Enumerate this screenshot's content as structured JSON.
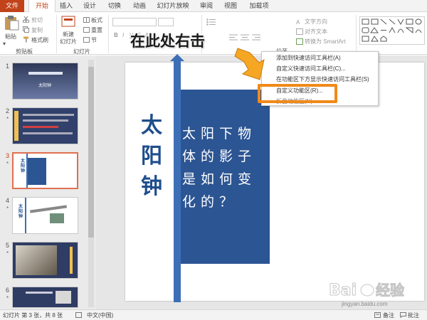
{
  "tabs": [
    "文件",
    "开始",
    "插入",
    "设计",
    "切换",
    "动画",
    "幻灯片放映",
    "审阅",
    "视图",
    "加载项"
  ],
  "ribbon": {
    "paste": "粘贴",
    "cut": "剪切",
    "copy": "复制",
    "format_painter": "格式刷",
    "clipboard_group": "剪贴板",
    "new_slide_line1": "新建",
    "new_slide_line2": "幻灯片",
    "layout": "板式",
    "reset": "重置",
    "section": "节",
    "slides_group": "幻灯片",
    "paragraph_group": "段落",
    "text_direction": "文字方向",
    "align_text": "对齐文本",
    "convert_smartart": "转换为 SmartArt"
  },
  "annotation": {
    "text": "在此处右击"
  },
  "context_menu": {
    "items": [
      "添加到快速访问工具栏(A)",
      "自定义快速访问工具栏(C)...",
      "在功能区下方显示快速访问工具栏(S)",
      "自定义功能区(R)...",
      "折叠功能区(N)"
    ]
  },
  "slides": {
    "numbers": [
      "1",
      "2",
      "3",
      "4",
      "5",
      "6"
    ],
    "marks": [
      "*",
      "*",
      "*",
      "*",
      "*"
    ],
    "thumb1_title": "太阳钟",
    "thumb3_left": "太阳钟",
    "thumb4_left": "太阳钟"
  },
  "slide": {
    "vertical_title": [
      "太",
      "阳",
      "钟"
    ],
    "box_lines": [
      "太阳下物",
      "体的影子",
      "是如何变",
      "化的？"
    ]
  },
  "status": {
    "slide_info": "幻灯片 第 3 张，共 8 张",
    "language": "中文(中国)",
    "notes": "备注",
    "comments": "批注"
  },
  "watermark": {
    "brand": "Baidu 经验",
    "url": "jingyan.baidu.com"
  },
  "colors": {
    "accent": "#c2421a",
    "slide_blue": "#2c5593",
    "highlight": "#f08a1a"
  }
}
